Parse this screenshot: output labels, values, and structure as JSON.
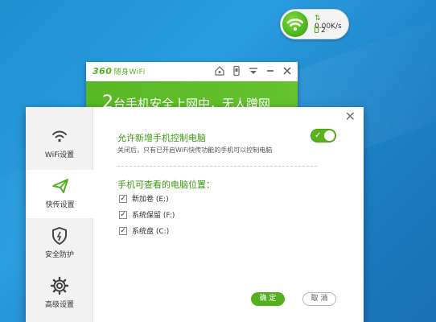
{
  "colors": {
    "accent": "#55b020",
    "desktop": "#2a9de0"
  },
  "widget": {
    "speed": "0.00K/s",
    "device_count": "2",
    "icons": [
      "wifi-icon",
      "upload-arrow-icon",
      "phone-icon"
    ]
  },
  "main_window": {
    "logo": "360",
    "logo_sub": "随身WiFi",
    "banner_number": "2",
    "banner_text": "台手机安全上网中，无人蹭网",
    "controls": [
      "home-shield-icon",
      "phone-icon",
      "menu-icon",
      "minimize-icon",
      "close-icon"
    ]
  },
  "dialog": {
    "nav": [
      {
        "label": "WiFi设置",
        "icon": "wifi-icon"
      },
      {
        "label": "快传设置",
        "icon": "send-icon"
      },
      {
        "label": "安全防护",
        "icon": "shield-icon"
      },
      {
        "label": "高级设置",
        "icon": "gear-icon"
      }
    ],
    "allow_title": "允许新增手机控制电脑",
    "allow_desc": "关闭后，只有已开启WiFi快传功能的手机可以控制电脑",
    "toggle_on": true,
    "view_title": "手机可查看的电脑位置：",
    "drives": [
      {
        "label": "新加卷 (E:)",
        "checked": true
      },
      {
        "label": "系统保留 (F:)",
        "checked": true
      },
      {
        "label": "系统盘 (C:)",
        "checked": true
      }
    ],
    "ok_label": "确 定",
    "cancel_label": "取 消"
  }
}
